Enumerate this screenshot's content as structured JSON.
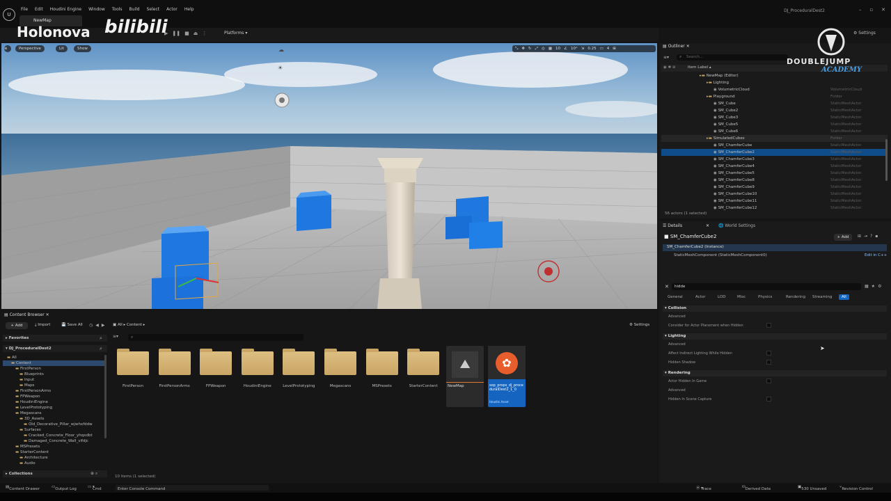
{
  "app": {
    "window_title": "DJ_ProceduralDest2",
    "map_tab": "NewMap",
    "menu": [
      "File",
      "Edit",
      "Houdini Engine",
      "Window",
      "Tools",
      "Build",
      "Select",
      "Actor",
      "Help"
    ],
    "platforms": "Platforms",
    "watermark_left": "Holonova",
    "watermark_bili": "bilibili",
    "watermark_right_top": "DOUBLEJUMP",
    "watermark_right_bottom": "ACADEMY"
  },
  "viewport": {
    "perspective": "Perspective",
    "lit": "Lit",
    "show": "Show",
    "tools": [
      "10",
      "10°",
      "0.25",
      "4"
    ]
  },
  "outliner": {
    "tab": "Outliner",
    "search_placeholder": "Search...",
    "column": "Item Label",
    "rows": [
      {
        "name": "NewMap (Editor)",
        "type": "",
        "indent": 1
      },
      {
        "name": "Lighting",
        "type": "",
        "indent": 2
      },
      {
        "name": "VolumetricCloud",
        "type": "VolumetricCloud",
        "indent": 3
      },
      {
        "name": "Playground",
        "type": "Folder",
        "indent": 2
      },
      {
        "name": "SM_Cube",
        "type": "StaticMeshActor",
        "indent": 3
      },
      {
        "name": "SM_Cube2",
        "type": "StaticMeshActor",
        "indent": 3
      },
      {
        "name": "SM_Cube3",
        "type": "StaticMeshActor",
        "indent": 3
      },
      {
        "name": "SM_Cube5",
        "type": "StaticMeshActor",
        "indent": 3
      },
      {
        "name": "SM_Cube6",
        "type": "StaticMeshActor",
        "indent": 3
      },
      {
        "name": "SimulatedCubes",
        "type": "Folder",
        "indent": 2
      },
      {
        "name": "SM_ChamferCube",
        "type": "StaticMeshActor",
        "indent": 3
      },
      {
        "name": "SM_ChamferCube2",
        "type": "StaticMeshActor",
        "indent": 3
      },
      {
        "name": "SM_ChamferCube3",
        "type": "StaticMeshActor",
        "indent": 3
      },
      {
        "name": "SM_ChamferCube4",
        "type": "StaticMeshActor",
        "indent": 3
      },
      {
        "name": "SM_ChamferCube5",
        "type": "StaticMeshActor",
        "indent": 3
      },
      {
        "name": "SM_ChamferCube8",
        "type": "StaticMeshActor",
        "indent": 3
      },
      {
        "name": "SM_ChamferCube9",
        "type": "StaticMeshActor",
        "indent": 3
      },
      {
        "name": "SM_ChamferCube10",
        "type": "StaticMeshActor",
        "indent": 3
      },
      {
        "name": "SM_ChamferCube11",
        "type": "StaticMeshActor",
        "indent": 3
      },
      {
        "name": "SM_ChamferCube12",
        "type": "StaticMeshActor",
        "indent": 3
      }
    ],
    "count": "56 actors (1 selected)"
  },
  "details": {
    "tab": "Details",
    "tab2": "World Settings",
    "actor": "SM_ChamferCube2",
    "add": "+ Add",
    "instance": "SM_ChamferCube2 (Instance)",
    "component": "StaticMeshComponent (StaticMeshComponent0)",
    "edit_cpp": "Edit in C++",
    "search": "hidde",
    "filters": [
      "General",
      "Actor",
      "LOD",
      "Misc",
      "Physics",
      "Rendering",
      "Streaming",
      "All"
    ],
    "sections": [
      {
        "cat": "Collision",
        "props": [
          "Advanced",
          "Consider for Actor Placement when Hidden"
        ]
      },
      {
        "cat": "Lighting",
        "props": [
          "Advanced",
          "Affect Indirect Lighting While Hidden",
          "Hidden Shadow"
        ]
      },
      {
        "cat": "Rendering",
        "props": [
          "Actor Hidden In Game",
          "Advanced",
          "Hidden In Scene Capture"
        ]
      }
    ]
  },
  "content_browser": {
    "tab": "Content Browser",
    "add": "+ Add",
    "import": "Import",
    "save_all": "Save All",
    "path": [
      "All",
      "Content"
    ],
    "settings": "Settings",
    "favorites": "Favorites",
    "project": "DJ_ProceduralDest2",
    "collections": "Collections",
    "status": "10 items (1 selected)",
    "tree": [
      {
        "label": "All",
        "indent": 0
      },
      {
        "label": "Content",
        "indent": 1
      },
      {
        "label": "FirstPerson",
        "indent": 2
      },
      {
        "label": "Blueprints",
        "indent": 3
      },
      {
        "label": "Input",
        "indent": 3
      },
      {
        "label": "Maps",
        "indent": 3
      },
      {
        "label": "FirstPersonArms",
        "indent": 2
      },
      {
        "label": "FPWeapon",
        "indent": 2
      },
      {
        "label": "HoudiniEngine",
        "indent": 2
      },
      {
        "label": "LevelPrototyping",
        "indent": 2
      },
      {
        "label": "Megascans",
        "indent": 2
      },
      {
        "label": "3D_Assets",
        "indent": 3
      },
      {
        "label": "Old_Decorative_Pillar_wjwhxfddw",
        "indent": 4
      },
      {
        "label": "Surfaces",
        "indent": 3
      },
      {
        "label": "Cracked_Concrete_Floor_yhqxdbt",
        "indent": 4
      },
      {
        "label": "Damaged_Concrete_Wall_vifdjc",
        "indent": 4
      },
      {
        "label": "MSPresets",
        "indent": 2
      },
      {
        "label": "StarterContent",
        "indent": 2
      },
      {
        "label": "Architecture",
        "indent": 3
      },
      {
        "label": "Audio",
        "indent": 3
      }
    ],
    "assets": [
      "FirstPerson",
      "FirstPersonArms",
      "FPWeapon",
      "HoudiniEngine",
      "LevelPrototyping",
      "Megascans",
      "MSPresets",
      "StarterContent"
    ],
    "map_asset": "NewMap",
    "hda_asset": "sop_props_dj_proceduralDest2_1_0",
    "hda_type": "Houdini Asset"
  },
  "statusbar": {
    "drawer": "Content Drawer",
    "output": "Output Log",
    "cmd": "Cmd",
    "console": "Enter Console Command",
    "trace": "Trace",
    "derived": "Derived Data",
    "unsaved": "530 Unsaved",
    "revision": "Revision Control"
  },
  "colors": {
    "accent": "#1565c0",
    "select": "#0e4d8a",
    "cube": "#1f78e0"
  }
}
